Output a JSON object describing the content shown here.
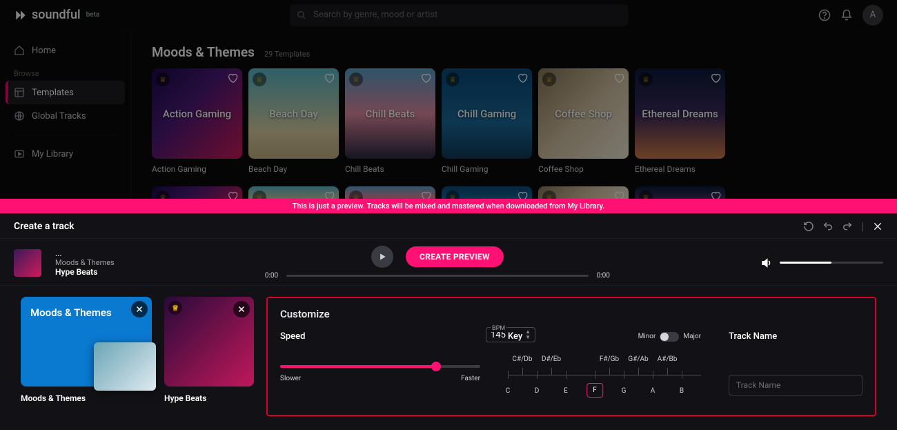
{
  "app": {
    "name": "soundful",
    "tag": "beta"
  },
  "search": {
    "placeholder": "Search by genre, mood or artist"
  },
  "header": {
    "avatar_initial": "A"
  },
  "sidebar": {
    "home": "Home",
    "browse_heading": "Browse",
    "templates": "Templates",
    "global_tracks": "Global Tracks",
    "my_library": "My Library"
  },
  "section": {
    "title": "Moods & Themes",
    "count": "29 Templates",
    "cards": [
      {
        "title": "Action Gaming",
        "label": "Action Gaming",
        "bg": "linear-gradient(135deg,#1a0a4a 0%,#4a1a7a 40%,#d01a5a 100%)"
      },
      {
        "title": "Beach Day",
        "label": "Beach Day",
        "bg": "linear-gradient(180deg,#59b8c8 0%,#d9cfa0 70%,#c2b080 100%)"
      },
      {
        "title": "Chill Beats",
        "label": "Chill Beats",
        "bg": "linear-gradient(180deg,#5aa0c8 0%,#e08aa0 50%,#2a2a40 100%)"
      },
      {
        "title": "Chill Gaming",
        "label": "Chill Gaming",
        "bg": "linear-gradient(180deg,#0a4a7a 0%,#1a6a9a 60%,#103a5a 100%)"
      },
      {
        "title": "Coffee Shop",
        "label": "Coffee Shop",
        "bg": "linear-gradient(135deg,#8a7a5a 0%,#d0c0a0 50%,#f0e8d8 100%)"
      },
      {
        "title": "Ethereal Dreams",
        "label": "Ethereal Dreams",
        "bg": "linear-gradient(180deg,#0a1a3a 0%,#3a2a5a 50%,#d07a4a 100%)"
      }
    ]
  },
  "banner": "This is just a preview. Tracks will be mixed and mastered when downloaded from My Library.",
  "create": {
    "panel_title": "Create a track",
    "ellipsis": "...",
    "category": "Moods & Themes",
    "track_name": "Hype Beats",
    "preview_btn": "CREATE PREVIEW",
    "time_start": "0:00",
    "time_end": "0:00"
  },
  "stacks": [
    {
      "title": "Moods & Themes",
      "label": "Moods & Themes"
    },
    {
      "title": "",
      "label": "Hype Beats"
    }
  ],
  "customize": {
    "title": "Customize",
    "speed_label": "Speed",
    "bpm_label": "BPM",
    "bpm_value": "145",
    "slower": "Slower",
    "faster": "Faster",
    "key_label": "Key",
    "minor": "Minor",
    "major": "Major",
    "trackname_label": "Track Name",
    "trackname_placeholder": "Track Name",
    "sharps": [
      "C#/Db",
      "D#/Eb",
      "F#/Gb",
      "G#/Ab",
      "A#/Bb"
    ],
    "naturals": [
      "C",
      "D",
      "E",
      "F",
      "G",
      "A",
      "B"
    ],
    "selected_key": "F"
  }
}
